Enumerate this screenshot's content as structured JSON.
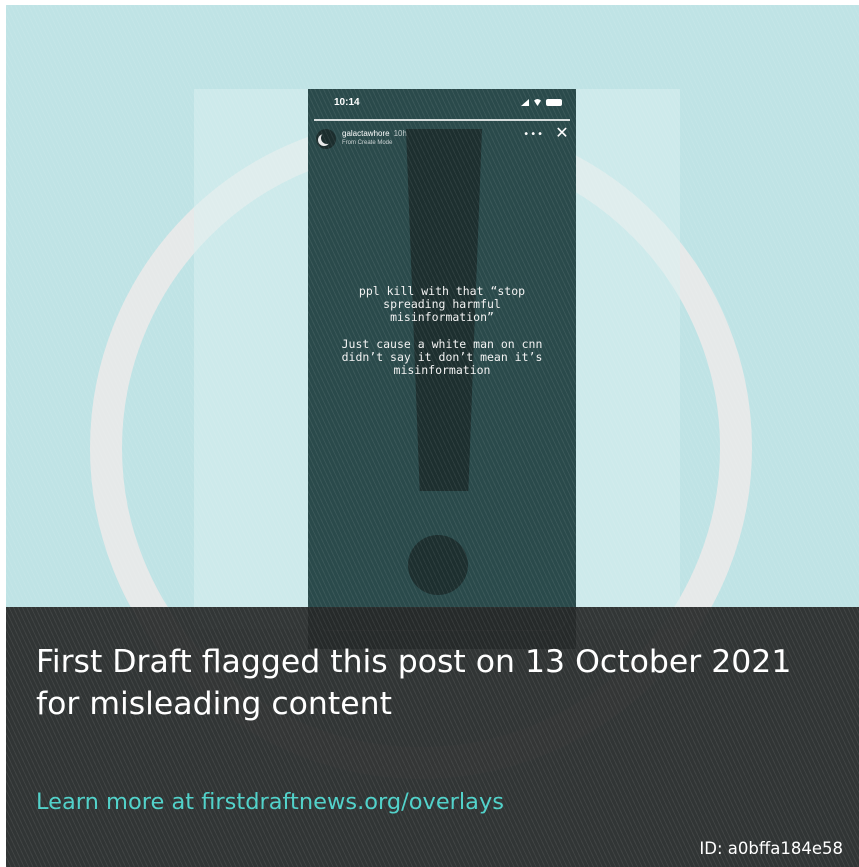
{
  "story": {
    "status_time": "10:14",
    "username": "galactawhore",
    "age": "10h",
    "subline": "From Create Mode",
    "more_icon": "more-icon",
    "close_icon": "close-icon",
    "text": [
      "ppl kill with that “stop spreading harmful misinformation”",
      "Just cause a white man on cnn didn’t say it don’t mean it’s misinformation"
    ]
  },
  "overlay": {
    "headline": "First Draft flagged this post on 13 October 2021 for misleading content",
    "link_text": "Learn more at firstdraftnews.org/overlays",
    "id_text": "ID: a0bffa184e58"
  },
  "colors": {
    "background": "#bfe3e5",
    "ring": "#e6e9e9",
    "phone": "#2a4a4b",
    "overlay": "#262828",
    "link": "#4fd1c9"
  }
}
